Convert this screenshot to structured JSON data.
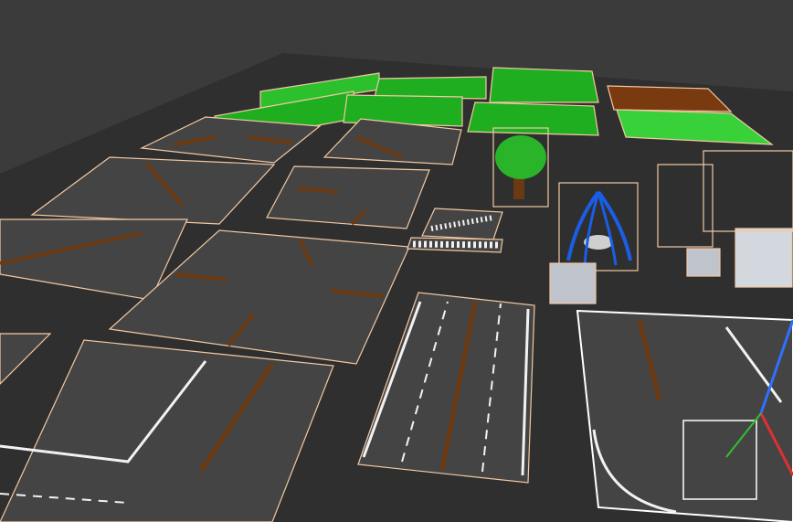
{
  "app": {
    "view": "3d-viewport"
  },
  "colors": {
    "background": "#3b3b3b",
    "ground_plane": "#2f2f2f",
    "grid_line": "#4a4a4a",
    "asphalt": "#444444",
    "lane_marking": "#f2f2f2",
    "median": "#6b3a12",
    "grass": "#1fae1f",
    "grass_light": "#39d139",
    "dirt": "#7a3a10",
    "selection_outline": "#f3c9a3",
    "active_selection": "#ffffff",
    "tree_foliage": "#2ab42a",
    "trunk": "#6b3a12",
    "fountain_water": "#1a5ee8",
    "stone": "#bfc4cc",
    "gizmo_x": "#e03030",
    "gizmo_y": "#30c030",
    "gizmo_z": "#3070ff"
  },
  "scene": {
    "object_types": [
      "grass-tile",
      "grass-tile",
      "grass-tile",
      "grass-tile",
      "grass-tile",
      "dirt-tile",
      "grass-tile",
      "road-corner",
      "road-corner",
      "road-straight",
      "road-t-junction",
      "road-diagonal",
      "road-crossroad",
      "crosswalk",
      "crosswalk",
      "road-straight-wide",
      "road-turn",
      "tree",
      "fountain",
      "stone-block",
      "stone-block",
      "wall-block"
    ],
    "selected_object": "road-turn",
    "gizmo_icon": "transform-gizmo-icon"
  }
}
